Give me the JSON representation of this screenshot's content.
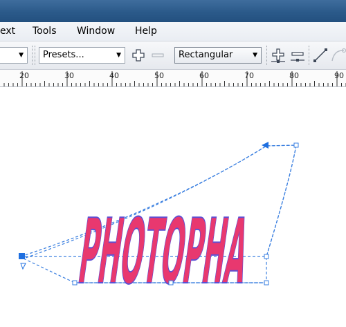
{
  "menu": {
    "text": "ext",
    "tools": "Tools",
    "window": "Window",
    "help": "Help"
  },
  "toolbar": {
    "presets": "Presets...",
    "shape_mode": "Rectangular"
  },
  "ruler": {
    "labels": [
      "20",
      "30",
      "40",
      "50",
      "60",
      "70",
      "80",
      "90"
    ]
  },
  "canvas": {
    "envelope_text": "PHOTOPHA"
  },
  "colors": {
    "text_fill": "#e8386f",
    "text_outline": "#5b4fd4",
    "envelope": "#3a7fe0",
    "title_bar": "#2b5a8a"
  }
}
